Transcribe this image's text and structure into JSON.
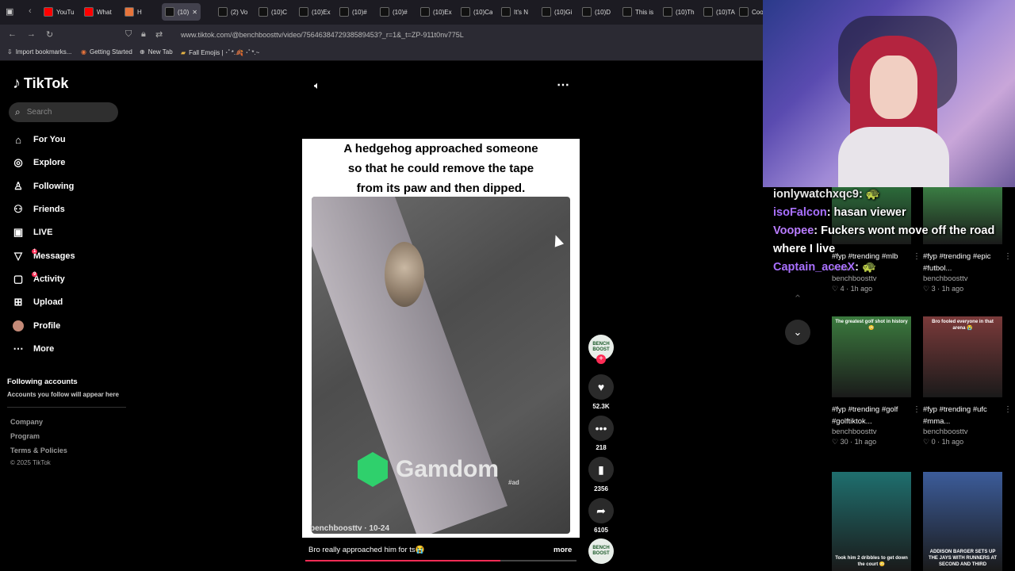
{
  "browser": {
    "tabs": [
      {
        "label": "YouTu",
        "color": "#ff0000"
      },
      {
        "label": "What",
        "color": "#ff0000"
      },
      {
        "label": "H",
        "color": "#e8743b"
      },
      {
        "label": "(10)",
        "color": "#000000",
        "active": true
      },
      {
        "label": "(2) Vo",
        "color": "#000000"
      },
      {
        "label": "(10)C",
        "color": "#000000"
      },
      {
        "label": "(10)Ex",
        "color": "#000000"
      },
      {
        "label": "(10)#",
        "color": "#000000"
      },
      {
        "label": "(10)#",
        "color": "#000000"
      },
      {
        "label": "(10)Ex",
        "color": "#000000"
      },
      {
        "label": "(10)Ca",
        "color": "#000000"
      },
      {
        "label": "It's N",
        "color": "#000000"
      },
      {
        "label": "(10)Gi",
        "color": "#000000"
      },
      {
        "label": "(10)D",
        "color": "#000000"
      },
      {
        "label": "This is",
        "color": "#000000"
      },
      {
        "label": "(10)Th",
        "color": "#000000"
      },
      {
        "label": "(10)TA",
        "color": "#000000"
      },
      {
        "label": "Coo",
        "color": "#000000"
      }
    ],
    "url": "www.tiktok.com/@benchboosttv/video/7564638472938589453?_r=1&_t=ZP-911t0nv775L",
    "bookmarks": [
      "Import bookmarks...",
      "Getting Started",
      "New Tab",
      "Fall Emojis | ･ﾟ*.🍂 ･ﾟ*.~"
    ]
  },
  "sidebar": {
    "brand": "TikTok",
    "search_placeholder": "Search",
    "items": [
      {
        "label": "For You",
        "icon": "home-icon",
        "glyph": "⌂"
      },
      {
        "label": "Explore",
        "icon": "compass-icon",
        "glyph": "◎"
      },
      {
        "label": "Following",
        "icon": "following-icon",
        "glyph": "♙"
      },
      {
        "label": "Friends",
        "icon": "friends-icon",
        "glyph": "⚇"
      },
      {
        "label": "LIVE",
        "icon": "live-icon",
        "glyph": "▣"
      },
      {
        "label": "Messages",
        "icon": "messages-icon",
        "glyph": "▽",
        "badge": "1"
      },
      {
        "label": "Activity",
        "icon": "activity-icon",
        "glyph": "▢",
        "badge": "9"
      },
      {
        "label": "Upload",
        "icon": "upload-icon",
        "glyph": "⊞"
      },
      {
        "label": "Profile",
        "icon": "profile-avatar-icon",
        "glyph": "●"
      },
      {
        "label": "More",
        "icon": "more-dots-icon",
        "glyph": "⋯"
      }
    ],
    "following_title": "Following accounts",
    "following_sub": "Accounts you follow will appear here",
    "footer": [
      "Company",
      "Program",
      "Terms & Policies"
    ],
    "copyright": "© 2025 TikTok"
  },
  "video": {
    "caption_lines": [
      "A hedgehog approached someone",
      "so that he could remove the tape",
      "from its paw and then dipped."
    ],
    "watermark": "Gamdom",
    "watermark_sub": "#ad",
    "overlay_user": "benchboosttv · 10-24",
    "description": "Bro really approached him for ts😭",
    "more_label": "more",
    "progress": 0.72
  },
  "actions": {
    "avatar_text": "BENCH BOOST",
    "likes": "52.3K",
    "comments": "218",
    "saves": "2356",
    "shares": "6105"
  },
  "chat": [
    {
      "user": "ionlywatchxqc9",
      "user_color": "#e8e8e8",
      "msg": ": 🐢"
    },
    {
      "user": "isoFalcon",
      "user_color": "#a970ff",
      "msg": ": hasan viewer"
    },
    {
      "user": "Voopee",
      "user_color": "#b97cff",
      "msg": ": Fuckers wont move off the road where I live"
    },
    {
      "user": "Captain_aceeX",
      "user_color": "#a970ff",
      "msg": ": 🐢"
    }
  ],
  "cards": [
    {
      "title": "#fyp #trending #mlb #mlb...",
      "author": "benchboosttv",
      "likes": "4",
      "time": "1h ago",
      "thumb_text": ""
    },
    {
      "title": "#fyp #trending #epic #futbol...",
      "author": "benchboosttv",
      "likes": "3",
      "time": "1h ago",
      "thumb_text": ""
    },
    {
      "title": "#fyp #trending #golf #golftiktok...",
      "author": "benchboosttv",
      "likes": "30",
      "time": "1h ago",
      "thumb_text": "The greatest golf shot in history 😳"
    },
    {
      "title": "#fyp #trending #ufc #mma...",
      "author": "benchboosttv",
      "likes": "0",
      "time": "1h ago",
      "thumb_text": "Bro fooled everyone in that arena 😭"
    },
    {
      "title": "",
      "author": "",
      "likes": "",
      "time": "",
      "thumb_text": "Took him 2 dribbles to get down the court 😳"
    },
    {
      "title": "",
      "author": "",
      "likes": "",
      "time": "",
      "thumb_text": "ADDISON BARGER SETS UP THE JAYS WITH RUNNERS AT SECOND AND THIRD"
    }
  ],
  "colors": {
    "accent": "#fe2c55",
    "panel": "#2a2a2a"
  }
}
